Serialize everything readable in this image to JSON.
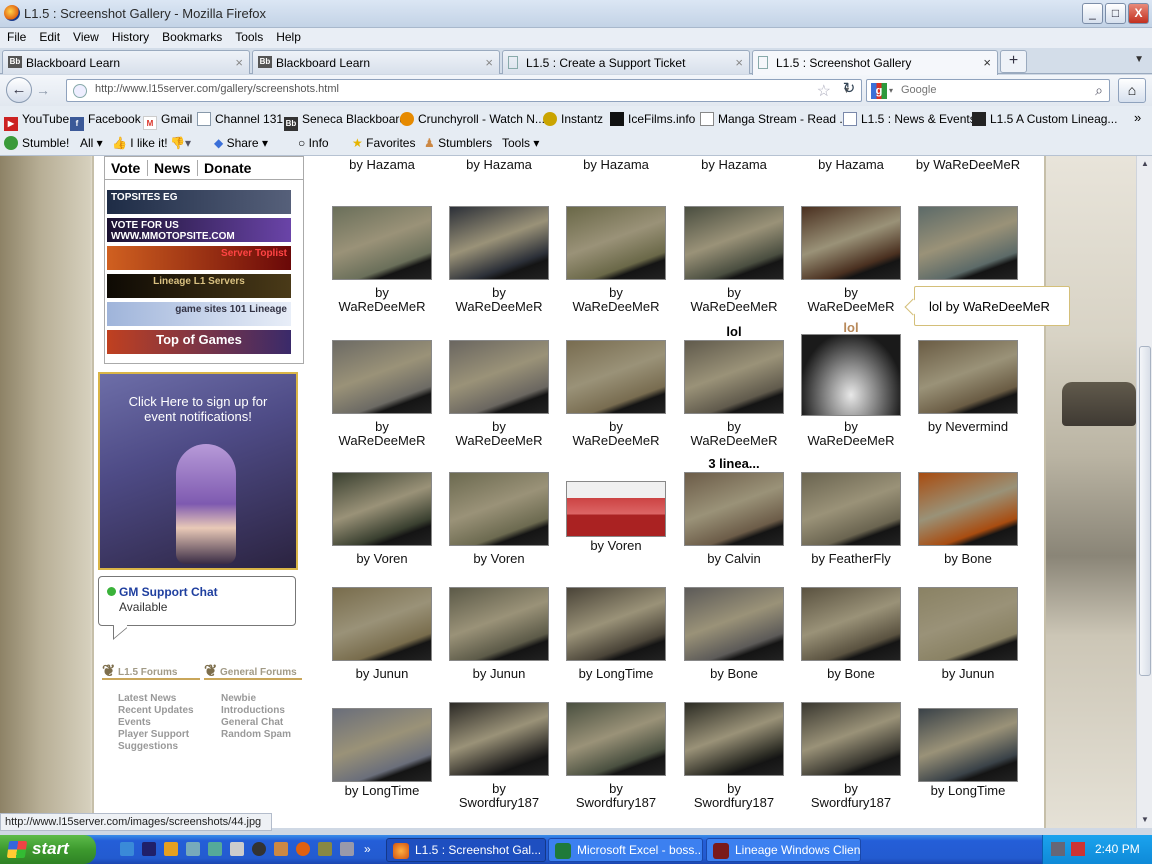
{
  "window": {
    "title": "L1.5 : Screenshot Gallery - Mozilla Firefox",
    "controls": [
      "_",
      "□",
      "X"
    ]
  },
  "menu": [
    "File",
    "Edit",
    "View",
    "History",
    "Bookmarks",
    "Tools",
    "Help"
  ],
  "tabs": [
    {
      "label": "Blackboard Learn",
      "icon": "Bb"
    },
    {
      "label": "Blackboard Learn",
      "icon": "Bb"
    },
    {
      "label": "L1.5 : Create a Support Ticket",
      "icon": ""
    },
    {
      "label": "L1.5 : Screenshot Gallery",
      "icon": ""
    }
  ],
  "nav": {
    "url": "http://www.l15server.com/gallery/screenshots.html",
    "search_placeholder": "Google"
  },
  "bookmarks": [
    {
      "label": "YouTube",
      "color": "#cc2222"
    },
    {
      "label": "Facebook",
      "color": "#3b5998"
    },
    {
      "label": "Gmail",
      "color": "#d93025"
    },
    {
      "label": "Channel 131",
      "color": "#8899aa"
    },
    {
      "label": "Seneca Blackboard",
      "color": "#333333"
    },
    {
      "label": "Crunchyroll - Watch N...",
      "color": "#e68a00"
    },
    {
      "label": "Instantz",
      "color": "#caa400"
    },
    {
      "label": "IceFilms.info",
      "color": "#111111"
    },
    {
      "label": "Manga Stream - Read ...",
      "color": "#555555"
    },
    {
      "label": "L1.5 : News & Events",
      "color": "#7a88aa"
    },
    {
      "label": "L1.5 A Custom Lineag...",
      "color": "#222222"
    }
  ],
  "stumble": {
    "stumble": "Stumble!",
    "all": "All",
    "like": "I like it!",
    "share": "Share",
    "info": "Info",
    "favorites": "Favorites",
    "stumblers": "Stumblers",
    "tools": "Tools"
  },
  "sidebar": {
    "tabs": [
      "Vote",
      "News",
      "Donate"
    ],
    "badges": [
      {
        "text": "TOPSITES  EG",
        "color": "#2a3a5a"
      },
      {
        "text": "VOTE FOR US  WWW.MMOTOPSITE.COM",
        "color": "#3a2460"
      },
      {
        "text": "Server Toplist",
        "color": "#7a1010"
      },
      {
        "text": "Lineage  L1 Servers",
        "color": "#2a2010"
      },
      {
        "text": "game sites 101  Lineage",
        "color": "#8da2c8"
      },
      {
        "text": "Top of Games",
        "color": "#5a2a2a"
      }
    ],
    "promo": "Click Here to sign up for event notifications!",
    "chat": {
      "title": "GM Support Chat",
      "status": "Available"
    },
    "forums": {
      "l15_heading": "L1.5 Forums",
      "general_heading": "General Forums",
      "l15_links": [
        "Latest News",
        "Recent Updates",
        "Events",
        "Player Support",
        "Suggestions"
      ],
      "general_links": [
        "Newbie",
        "Introductions",
        "General Chat",
        "Random Spam"
      ]
    }
  },
  "gallery": {
    "top_captions": [
      "by Hazama",
      "by Hazama",
      "by Hazama",
      "by Hazama",
      "by Hazama",
      "by\nWaReDeeMeR"
    ],
    "rows": [
      [
        {
          "title": "",
          "cap": "by\nWaReDeeMeR",
          "color": "#6a6f5a"
        },
        {
          "title": "",
          "cap": "by\nWaReDeeMeR",
          "color": "#2c3038"
        },
        {
          "title": "",
          "cap": "by\nWaReDeeMeR",
          "color": "#6a6848"
        },
        {
          "title": "",
          "cap": "by\nWaReDeeMeR",
          "color": "#4a4e40"
        },
        {
          "title": "",
          "cap": "by\nWaReDeeMeR",
          "color": "#4a3020"
        },
        {
          "title": "",
          "cap": "by",
          "color": "#5c6a68"
        }
      ],
      [
        {
          "title": "",
          "cap": "by\nWaReDeeMeR",
          "color": "#6c6a64"
        },
        {
          "title": "",
          "cap": "by\nWaReDeeMeR",
          "color": "#6a6660"
        },
        {
          "title": "",
          "cap": "by\nWaReDeeMeR",
          "color": "#786c50"
        },
        {
          "title": "lol",
          "cap": "by\nWaReDeeMeR",
          "color": "#605a4c"
        },
        {
          "title": "lol",
          "cap": "by\nWaReDeeMeR",
          "color": "#1a1a1a"
        },
        {
          "title": "",
          "cap": "by Nevermind",
          "color": "#6a5c44"
        }
      ],
      [
        {
          "title": "",
          "cap": "by Voren",
          "color": "#3a4030"
        },
        {
          "title": "",
          "cap": "by Voren",
          "color": "#6c6a50"
        },
        {
          "title": "",
          "cap": "by Voren",
          "color": "#c05050"
        },
        {
          "title": "3 linea...",
          "cap": "by Calvin",
          "color": "#6c5c48"
        },
        {
          "title": "",
          "cap": "by FeatherFly",
          "color": "#6a6450"
        },
        {
          "title": "",
          "cap": "by Bone",
          "color": "#a84c10"
        }
      ],
      [
        {
          "title": "",
          "cap": "by Junun",
          "color": "#786c4c"
        },
        {
          "title": "",
          "cap": "by Junun",
          "color": "#5c5a48"
        },
        {
          "title": "",
          "cap": "by LongTime",
          "color": "#4a4438"
        },
        {
          "title": "",
          "cap": "by Bone",
          "color": "#5c5a58"
        },
        {
          "title": "",
          "cap": "by Bone",
          "color": "#5a5240"
        },
        {
          "title": "",
          "cap": "by Junun",
          "color": "#8a8264"
        }
      ],
      [
        {
          "title": "",
          "cap": "by LongTime",
          "color": "#6a6e7a"
        },
        {
          "title": "",
          "cap": "by\nSwordfury187",
          "color": "#2c2a26"
        },
        {
          "title": "",
          "cap": "by\nSwordfury187",
          "color": "#4a5040"
        },
        {
          "title": "",
          "cap": "by\nSwordfury187",
          "color": "#2c2c24"
        },
        {
          "title": "",
          "cap": "by\nSwordfury187",
          "color": "#3a3830"
        },
        {
          "title": "",
          "cap": "by LongTime",
          "color": "#3a4248"
        }
      ]
    ],
    "tooltip": "lol by WaReDeeMeR"
  },
  "statusbar": "http://www.l15server.com/images/screenshots/44.jpg",
  "taskbar": {
    "start": "start",
    "tasks": [
      "L1.5 : Screenshot Gal...",
      "Microsoft Excel - boss...",
      "Lineage Windows Client"
    ],
    "clock": "2:40 PM"
  }
}
